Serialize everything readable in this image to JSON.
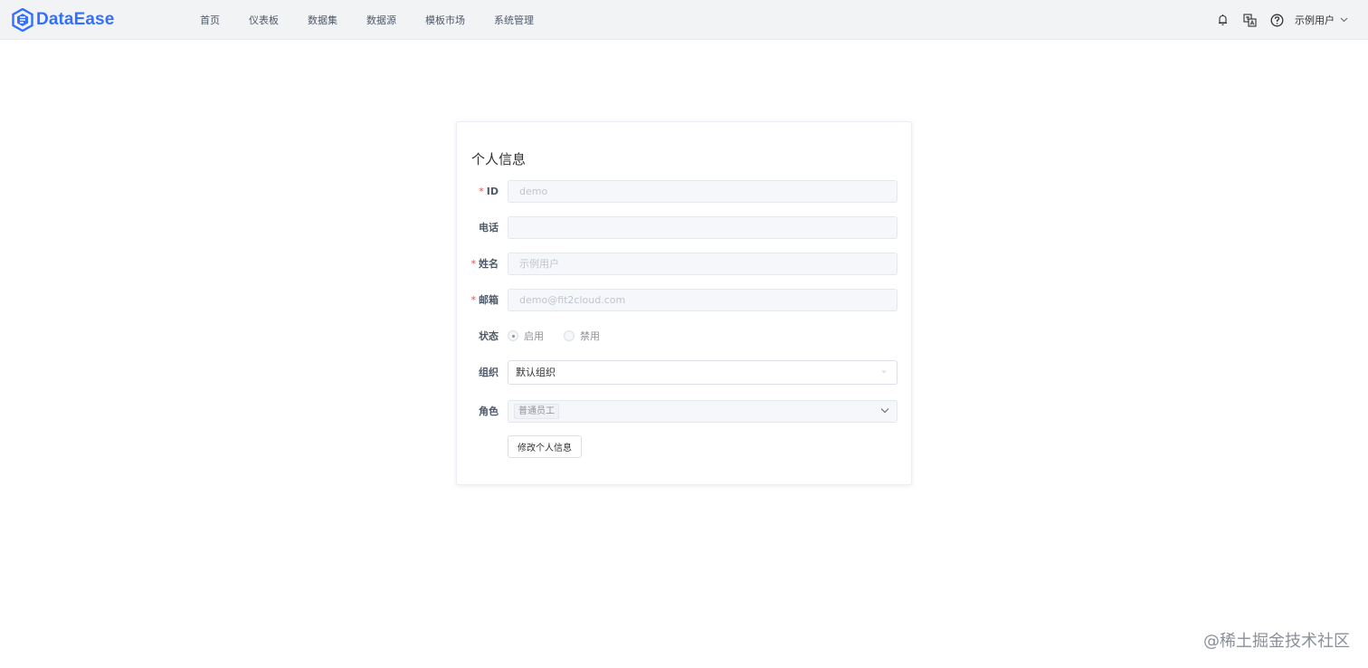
{
  "app": {
    "brand": "DataEase",
    "brand_color": "#3370ff"
  },
  "nav": {
    "items": [
      {
        "label": "首页"
      },
      {
        "label": "仪表板"
      },
      {
        "label": "数据集"
      },
      {
        "label": "数据源"
      },
      {
        "label": "模板市场"
      },
      {
        "label": "系统管理"
      }
    ]
  },
  "header": {
    "icons": [
      "bell-icon",
      "translate-icon",
      "help-icon"
    ],
    "user_name": "示例用户"
  },
  "profile": {
    "title": "个人信息",
    "fields": {
      "id": {
        "label": "ID",
        "required": true,
        "value": "demo"
      },
      "phone": {
        "label": "电话",
        "required": false,
        "value": ""
      },
      "name": {
        "label": "姓名",
        "required": true,
        "value": "示例用户"
      },
      "email": {
        "label": "邮箱",
        "required": true,
        "value": "demo@fit2cloud.com"
      },
      "status": {
        "label": "状态",
        "options": [
          "启用",
          "禁用"
        ],
        "selected": "启用"
      },
      "org": {
        "label": "组织",
        "value": "默认组织"
      },
      "role": {
        "label": "角色",
        "tags": [
          "普通员工"
        ]
      }
    },
    "submit_label": "修改个人信息"
  },
  "watermark": "@稀土掘金技术社区"
}
